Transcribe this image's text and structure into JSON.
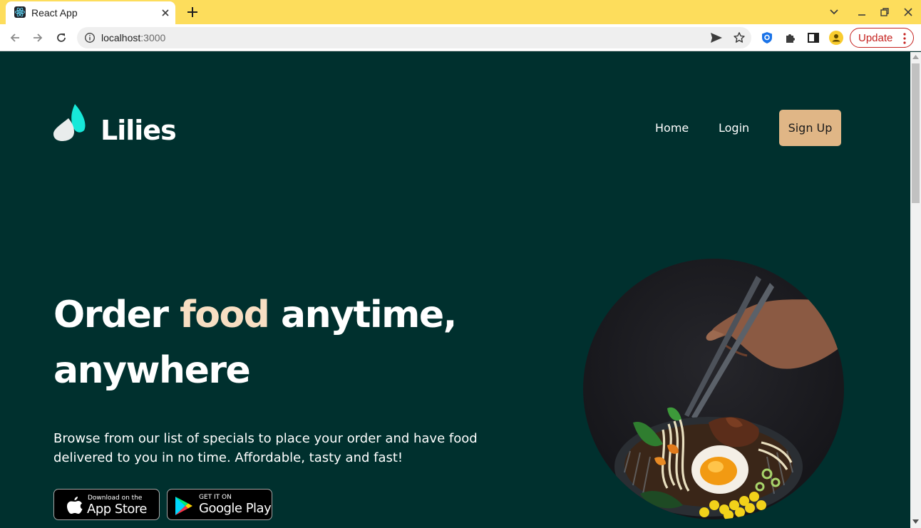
{
  "browser": {
    "tab_title": "React App",
    "url_host": "localhost",
    "url_port": ":3000",
    "update_label": "Update"
  },
  "site": {
    "brand": "Lilies",
    "nav": {
      "home": "Home",
      "login": "Login",
      "signup": "Sign Up"
    },
    "hero": {
      "headline_start": "Order ",
      "headline_accent": "food",
      "headline_end": " anytime, anywhere",
      "subtext": "Browse from our list of specials to place your order and have food delivered to you in no time. Affordable, tasty and fast!"
    },
    "stores": {
      "apple_small": "Download on the",
      "apple_big": "App Store",
      "google_small": "GET IT ON",
      "google_big": "Google Play"
    }
  },
  "colors": {
    "background": "#00302e",
    "accent_text": "#f8dfc3",
    "signup_button": "#e0b686",
    "tabstrip": "#fddd5c",
    "logo_teal": "#17e8d9"
  },
  "icons": [
    "react-favicon",
    "close-icon",
    "plus-icon",
    "chevron-down-icon",
    "minimize-icon",
    "restore-icon",
    "back-arrow-icon",
    "forward-arrow-icon",
    "reload-icon",
    "info-icon",
    "send-icon",
    "star-icon",
    "shield-extension-icon",
    "puzzle-icon",
    "side-panel-icon",
    "profile-icon",
    "more-vert-icon",
    "lilies-logo",
    "apple-icon",
    "google-play-icon"
  ]
}
